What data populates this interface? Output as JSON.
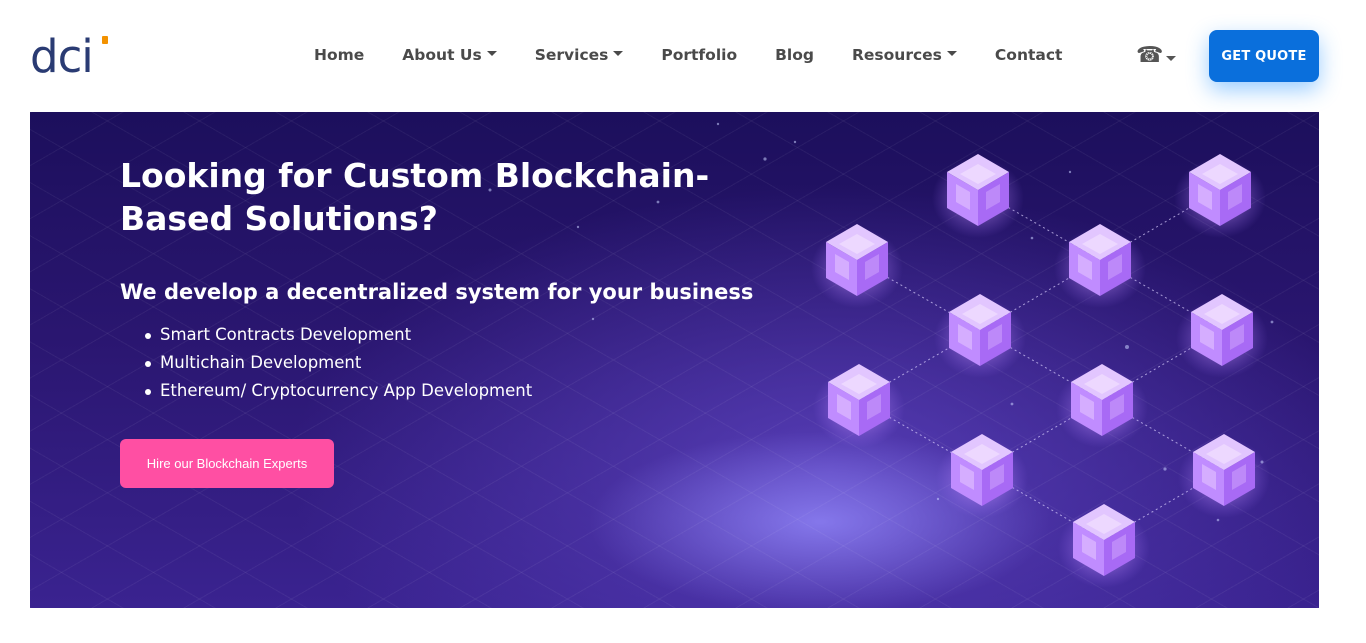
{
  "header": {
    "logo_text": "dci",
    "nav": [
      {
        "label": "Home",
        "dropdown": false
      },
      {
        "label": "About Us",
        "dropdown": true
      },
      {
        "label": "Services",
        "dropdown": true
      },
      {
        "label": "Portfolio",
        "dropdown": false
      },
      {
        "label": "Blog",
        "dropdown": false
      },
      {
        "label": "Resources",
        "dropdown": true
      },
      {
        "label": "Contact",
        "dropdown": false
      }
    ],
    "phone_icon": "phone-icon",
    "quote_label": "GET QUOTE"
  },
  "hero": {
    "title": "Looking for Custom Blockchain-Based Solutions?",
    "subtitle": "We develop a decentralized system for your business",
    "bullets": [
      "Smart Contracts Development",
      "Multichain Development",
      "Ethereum/ Cryptocurrency App Development"
    ],
    "cta_label": "Hire our Blockchain Experts"
  },
  "colors": {
    "brand_navy": "#2a3b73",
    "brand_orange": "#f39200",
    "quote_button": "#0a6fdc",
    "cta_button": "#ff4fa3",
    "hero_bg": "#2a1670",
    "cube": "#b07cff"
  }
}
